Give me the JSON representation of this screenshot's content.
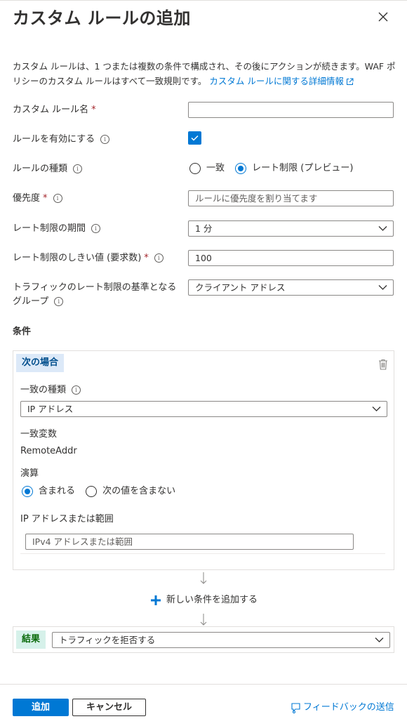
{
  "panel": {
    "title": "カスタム ルールの追加",
    "description": "カスタム ルールは、1 つまたは複数の条件で構成され、その後にアクションが続きます。WAF ポリシーのカスタム ルールはすべて一致規則です。",
    "learn_more_link": "カスタム ルールに関する詳細情報"
  },
  "form": {
    "rule_name": {
      "label": "カスタム ルール名",
      "required_mark": "*",
      "value": ""
    },
    "enable_rule": {
      "label": "ルールを有効にする",
      "checked": true
    },
    "rule_type": {
      "label": "ルールの種類",
      "options": [
        "一致",
        "レート制限 (プレビュー)"
      ],
      "selected": "レート制限 (プレビュー)"
    },
    "priority": {
      "label": "優先度",
      "required_mark": "*",
      "placeholder": "ルールに優先度を割り当てます"
    },
    "rate_limit_duration": {
      "label": "レート制限の期間",
      "value": "1 分"
    },
    "rate_limit_threshold": {
      "label": "レート制限のしきい値 (要求数)",
      "required_mark": "*",
      "value": "100"
    },
    "group_by": {
      "label_line1": "トラフィックのレート制限の基準となる",
      "label_line2": "グループ",
      "value": "クライアント アドレス"
    }
  },
  "conditions": {
    "heading": "条件",
    "if_badge": "次の場合",
    "match_type": {
      "label": "一致の種類",
      "value": "IP アドレス"
    },
    "match_variable": {
      "label": "一致変数",
      "value": "RemoteAddr"
    },
    "operation": {
      "label": "演算",
      "options": [
        "含まれる",
        "次の値を含まない"
      ],
      "selected": "含まれる"
    },
    "ip_range": {
      "label": "IP アドレスまたは範囲",
      "placeholder": "IPv4 アドレスまたは範囲"
    },
    "add_condition": "新しい条件を追加する"
  },
  "result": {
    "badge": "結果",
    "value": "トラフィックを拒否する"
  },
  "footer": {
    "add_button": "追加",
    "cancel_button": "キャンセル",
    "feedback": "フィードバックの送信"
  },
  "colors": {
    "accent": "#0078d4",
    "required": "#a4262c"
  }
}
